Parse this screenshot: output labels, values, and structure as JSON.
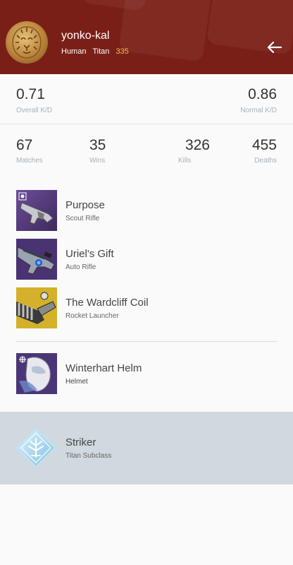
{
  "header": {
    "player_name": "yonko-kal",
    "race": "Human",
    "class": "Titan",
    "light_level": "335",
    "back_icon": "arrow-left-icon",
    "background_color": "#7a1f17"
  },
  "kd": {
    "overall_value": "0.71",
    "overall_label": "Overall K/D",
    "normal_value": "0.86",
    "normal_label": "Normal K/D"
  },
  "stats": [
    {
      "value": "67",
      "label": "Matches"
    },
    {
      "value": "35",
      "label": "Wins"
    },
    {
      "value": "326",
      "label": "Kills"
    },
    {
      "value": "455",
      "label": "Deaths"
    }
  ],
  "weapons": [
    {
      "name": "Purpose",
      "type": "Scout Rifle",
      "icon": "scout-rifle-icon"
    },
    {
      "name": "Uriel's Gift",
      "type": "Auto Rifle",
      "icon": "auto-rifle-icon"
    },
    {
      "name": "The Wardcliff Coil",
      "type": "Rocket Launcher",
      "icon": "rocket-launcher-icon"
    }
  ],
  "armor": [
    {
      "name": "Winterhart Helm",
      "type": "Helmet",
      "icon": "helmet-icon"
    }
  ],
  "subclass": {
    "name": "Striker",
    "type": "Titan Subclass",
    "icon": "striker-subclass-icon",
    "background_color": "#d0d9df"
  }
}
